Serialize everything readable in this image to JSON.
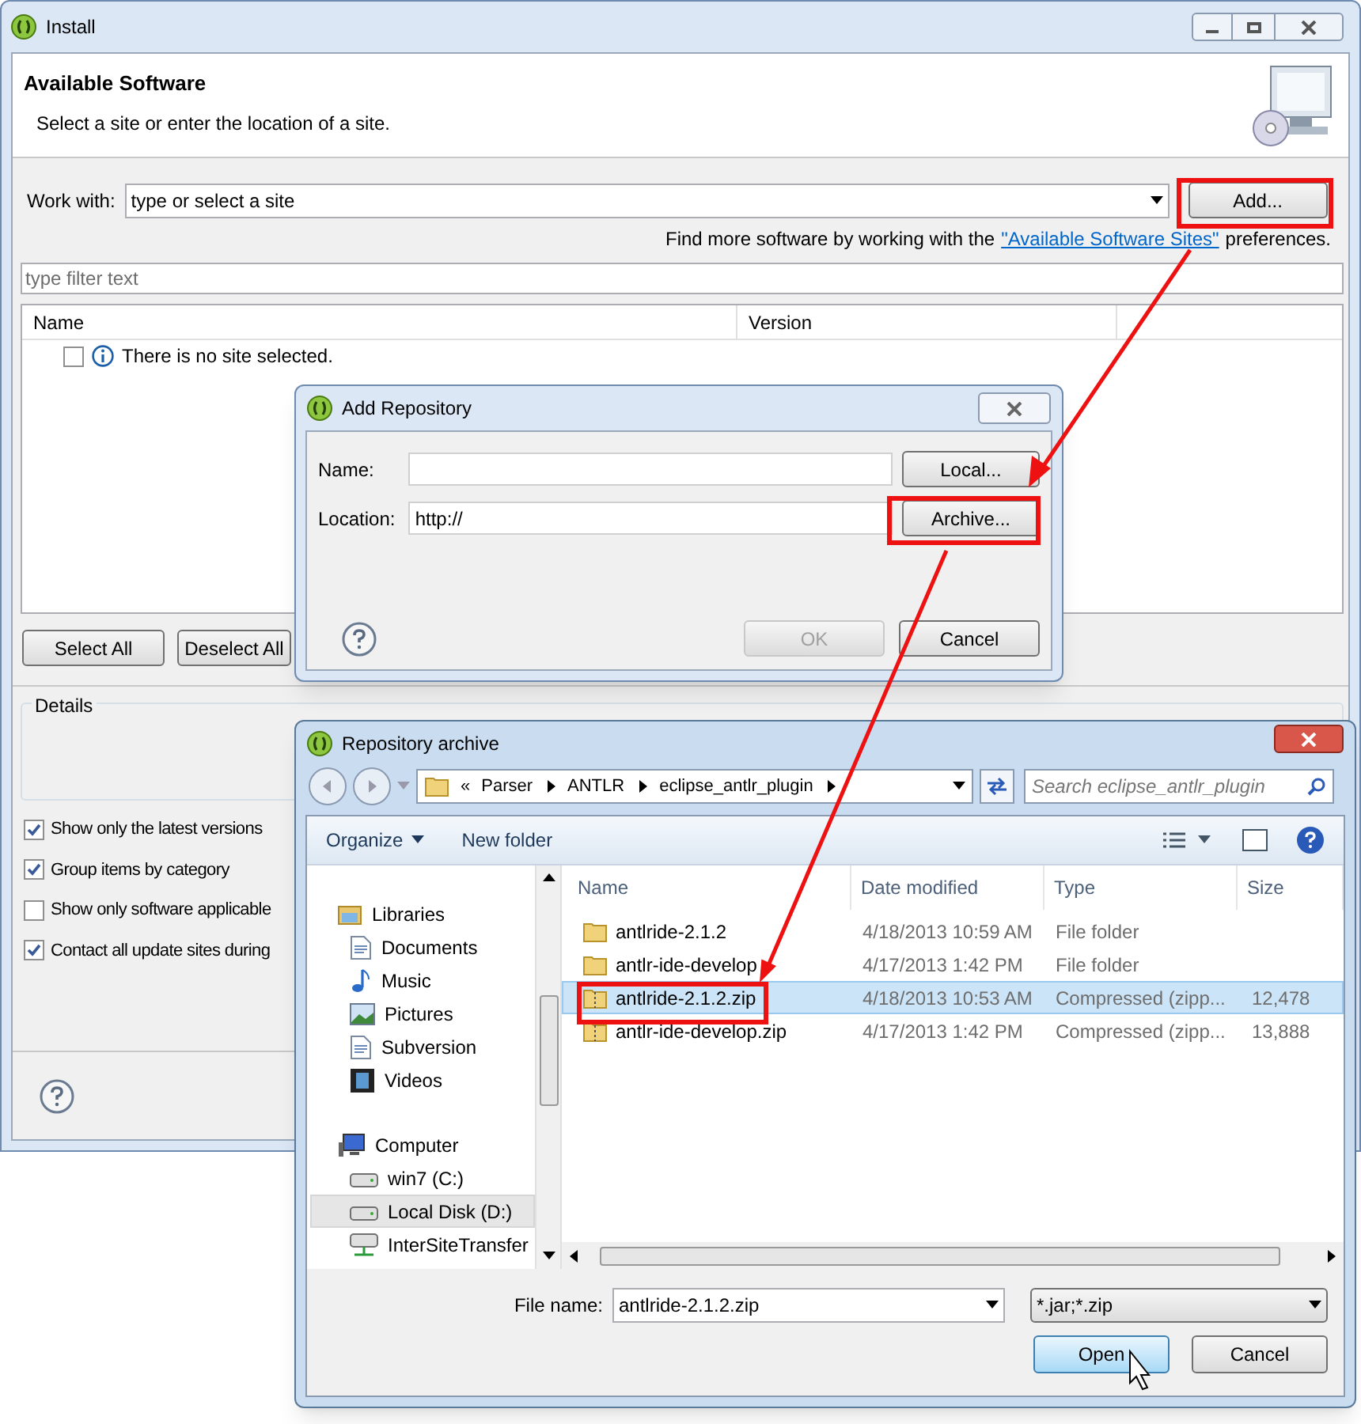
{
  "install_window": {
    "title": "Install",
    "header_title": "Available Software",
    "header_subtitle": "Select a site or enter the location of a site.",
    "work_with_label": "Work with:",
    "work_with_value": "type or select a site",
    "add_button": "Add...",
    "find_more_prefix": "Find more software by working with the",
    "find_more_link": "\"Available Software Sites\"",
    "find_more_suffix": "preferences.",
    "filter_placeholder": "type filter text",
    "table_columns": [
      "Name",
      "Version"
    ],
    "table_rows": [
      {
        "name": "There is no site selected.",
        "checked": false
      }
    ],
    "buttons": [
      "Select All",
      "Deselect All"
    ],
    "details_label": "Details",
    "options": [
      {
        "label": "Show only the latest versions",
        "checked": true
      },
      {
        "label": "Group items by category",
        "checked": true
      },
      {
        "label": "Show only software applicable",
        "checked": false
      },
      {
        "label": "Contact all update sites during",
        "checked": true
      }
    ]
  },
  "add_repository": {
    "title": "Add Repository",
    "fields": [
      {
        "label": "Name:",
        "button": "Local..."
      },
      {
        "label": "Location:",
        "value": "http://",
        "button": "Archive..."
      }
    ],
    "buttons": [
      {
        "label": "OK",
        "disabled": true
      },
      {
        "label": "Cancel",
        "disabled": false
      }
    ]
  },
  "repository_archive": {
    "title": "Repository archive",
    "breadcrumb_prefix": "«",
    "breadcrumb": [
      "Parser",
      "ANTLR",
      "eclipse_antlr_plugin"
    ],
    "search_placeholder": "Search eclipse_antlr_plugin",
    "toolbar": [
      "Organize",
      "New folder"
    ],
    "nav": [
      {
        "label": "Libraries",
        "kind": "libraries",
        "selected": false,
        "children": [
          {
            "label": "Documents",
            "kind": "documents",
            "selected": false
          },
          {
            "label": "Music",
            "kind": "music",
            "selected": false
          },
          {
            "label": "Pictures",
            "kind": "pictures",
            "selected": false
          },
          {
            "label": "Subversion",
            "kind": "documents",
            "selected": false
          },
          {
            "label": "Videos",
            "kind": "videos",
            "selected": false
          }
        ]
      },
      {
        "label": "Computer",
        "kind": "computer",
        "selected": false,
        "children": [
          {
            "label": "win7 (C:)",
            "kind": "drive",
            "selected": false
          },
          {
            "label": "Local Disk (D:)",
            "kind": "drive",
            "selected": true
          },
          {
            "label": "InterSiteTransfer",
            "kind": "network",
            "selected": false
          }
        ]
      }
    ],
    "columns": [
      "Name",
      "Date modified",
      "Type",
      "Size"
    ],
    "files": [
      {
        "name": "antlride-2.1.2",
        "date": "4/18/2013 10:59 AM",
        "type": "File folder",
        "kind": "folder",
        "selected": false
      },
      {
        "name": "antlr-ide-develop",
        "date": "4/17/2013 1:42 PM",
        "type": "File folder",
        "kind": "folder",
        "selected": false
      },
      {
        "name": "antlride-2.1.2.zip",
        "date": "4/18/2013 10:53 AM",
        "type": "Compressed (zipp...",
        "size": "12,478",
        "kind": "zip",
        "selected": true
      },
      {
        "name": "antlr-ide-develop.zip",
        "date": "4/17/2013 1:42 PM",
        "type": "Compressed (zipp...",
        "size": "13,888",
        "kind": "zip",
        "selected": false
      }
    ],
    "file_name_label": "File name:",
    "file_name_value": "antlride-2.1.2.zip",
    "filter_value": "*.jar;*.zip",
    "buttons": [
      "Open",
      "Cancel"
    ]
  }
}
